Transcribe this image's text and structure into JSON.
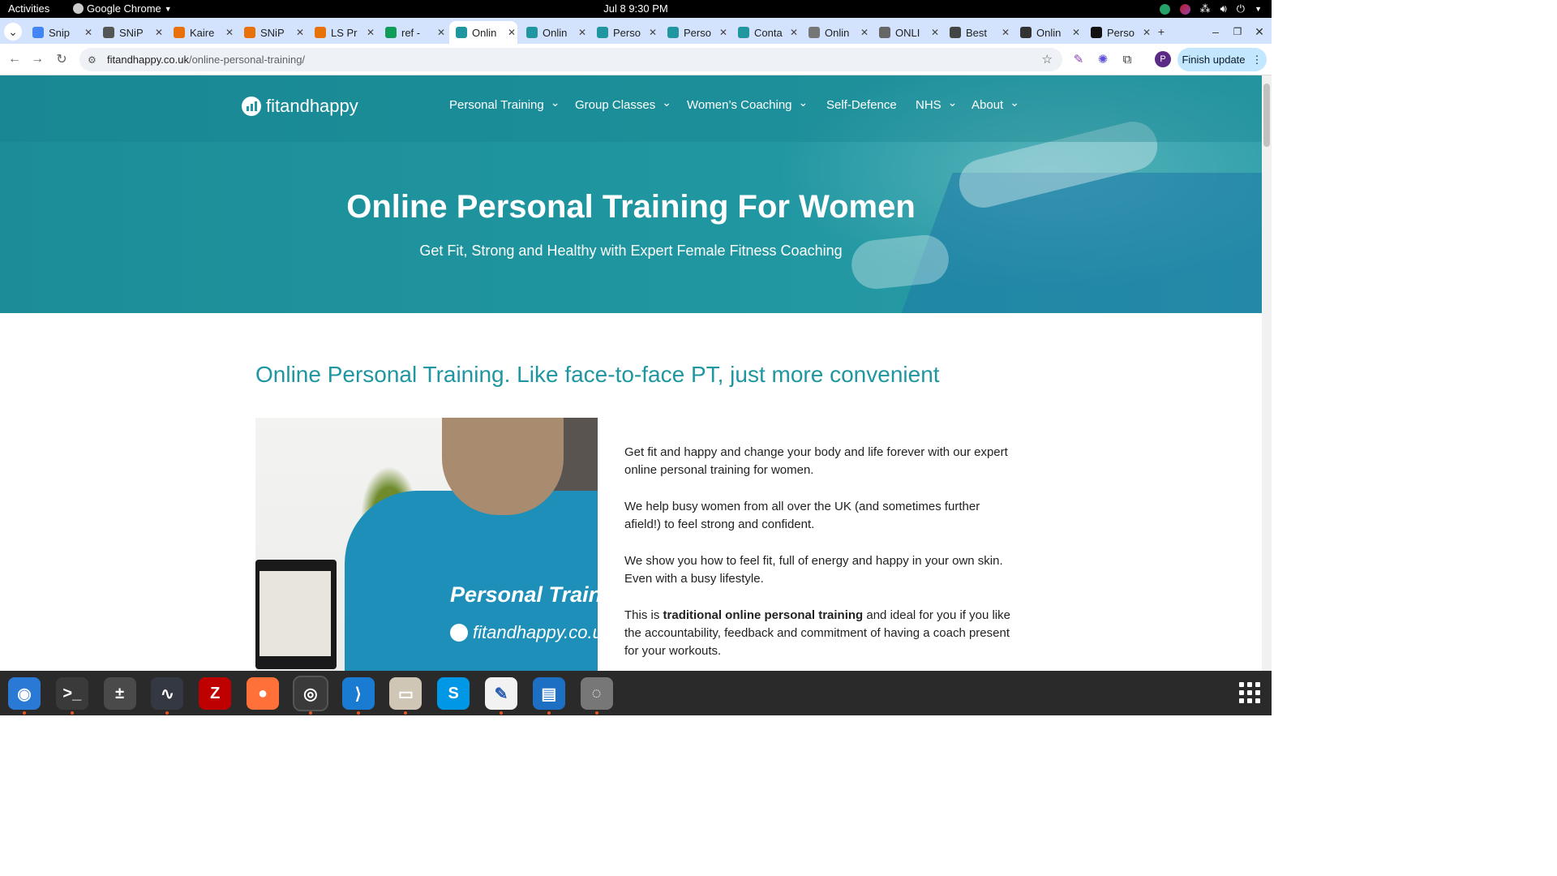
{
  "system": {
    "activities": "Activities",
    "app_name": "Google Chrome",
    "clock": "Jul 8  9:30 PM"
  },
  "tabs": [
    {
      "title": "Snip",
      "color": "#4285f4"
    },
    {
      "title": "SNiP",
      "color": "#555555"
    },
    {
      "title": "Kaire",
      "color": "#e8710a"
    },
    {
      "title": "SNiP",
      "color": "#e8710a"
    },
    {
      "title": "LS Pr",
      "color": "#e8710a"
    },
    {
      "title": "ref -",
      "color": "#0f9d58"
    },
    {
      "title": "Onlin",
      "color": "#1f96a0",
      "active": true
    },
    {
      "title": "Onlin",
      "color": "#1f96a0"
    },
    {
      "title": "Perso",
      "color": "#1f96a0"
    },
    {
      "title": "Perso",
      "color": "#1f96a0"
    },
    {
      "title": "Conta",
      "color": "#1f96a0"
    },
    {
      "title": "Onlin",
      "color": "#777777"
    },
    {
      "title": "ONLI",
      "color": "#666666"
    },
    {
      "title": "Best",
      "color": "#444444"
    },
    {
      "title": "Onlin",
      "color": "#333333"
    },
    {
      "title": "Perso",
      "color": "#111111"
    }
  ],
  "omnibox": {
    "url_domain": "fitandhappy.co.uk",
    "url_path": "/online-personal-training/"
  },
  "toolbar": {
    "finish_update": "Finish update",
    "profile_initial": "P"
  },
  "site": {
    "logo_text": "fitandhappy",
    "nav": [
      {
        "label": "Personal Training",
        "has_dropdown": true
      },
      {
        "label": "Group Classes",
        "has_dropdown": true
      },
      {
        "label": "Women’s Coaching",
        "has_dropdown": true
      },
      {
        "label": "Self-Defence",
        "has_dropdown": false
      },
      {
        "label": "NHS",
        "has_dropdown": true
      },
      {
        "label": "About",
        "has_dropdown": true
      }
    ],
    "hero_title": "Online Personal Training For Women",
    "hero_subtitle": "Get Fit, Strong and Healthy with Expert Female Fitness Coaching",
    "section_heading": "Online Personal Training. Like face-to-face PT, just more convenient",
    "photo_shirt_text": "Personal Traine",
    "photo_shirt_url": "fitandhappy.co.u",
    "paragraphs": [
      {
        "text": "Get fit and happy and change your body and life forever with our expert online personal training for women."
      },
      {
        "text": "We help busy women from all over the UK (and sometimes further afield!) to feel strong and confident."
      },
      {
        "text": "We show you how to feel fit, full of energy and happy in your own skin. Even with a busy lifestyle."
      },
      {
        "pre": "This is ",
        "bold": "traditional online personal training",
        "post": " and ideal for you if you like the accountability, feedback and commitment of having a coach present for your workouts."
      }
    ]
  },
  "colors": {
    "brand_teal": "#1f96a0",
    "tab_strip": "#d3e3fd",
    "update_button": "#c2e7ff"
  },
  "dock": [
    {
      "name": "thunderbird",
      "color": "#2a7ad5",
      "running": true
    },
    {
      "name": "terminal",
      "color": "#3a3a3a",
      "running": true
    },
    {
      "name": "calculator",
      "color": "#4a4a4a",
      "running": false
    },
    {
      "name": "system-monitor",
      "color": "#333842",
      "running": true
    },
    {
      "name": "filezilla",
      "color": "#bf0000",
      "running": false
    },
    {
      "name": "firefox",
      "color": "#ff7139",
      "running": false
    },
    {
      "name": "chrome",
      "color": "#4285f4",
      "running": true
    },
    {
      "name": "vscode",
      "color": "#1a7bd2",
      "running": true
    },
    {
      "name": "files",
      "color": "#cfc6b6",
      "running": true
    },
    {
      "name": "skype",
      "color": "#0098e6",
      "running": false
    },
    {
      "name": "text-editor",
      "color": "#f2f2f2",
      "running": true
    },
    {
      "name": "libreoffice-writer",
      "color": "#1d6fc4",
      "running": true
    },
    {
      "name": "disks",
      "color": "#777777",
      "running": true
    }
  ]
}
